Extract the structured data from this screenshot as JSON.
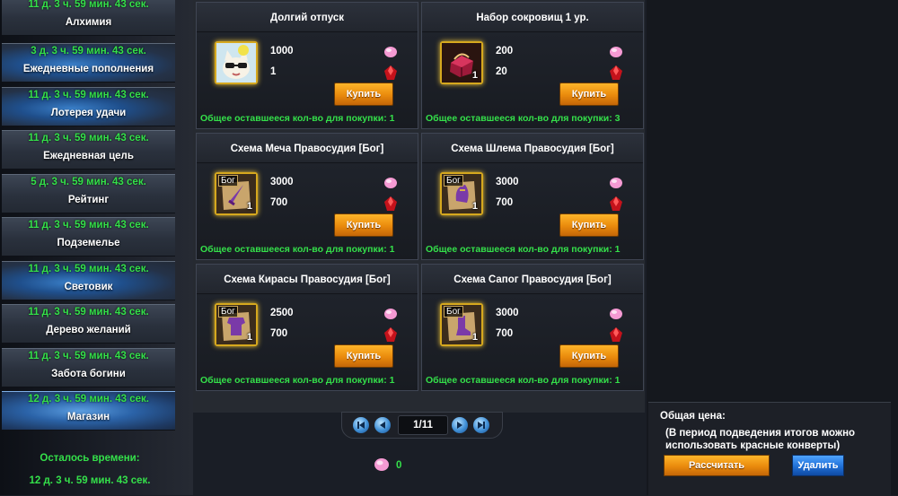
{
  "sidebar": {
    "items": [
      {
        "timer": "11 д. 3 ч. 59 мин. 43 сек.",
        "label": "Алхимия"
      },
      {
        "timer": "3 д. 3 ч. 59 мин. 43 сек.",
        "label": "Ежедневные пополнения"
      },
      {
        "timer": "11 д. 3 ч. 59 мин. 43 сек.",
        "label": "Лотерея удачи"
      },
      {
        "timer": "11 д. 3 ч. 59 мин. 43 сек.",
        "label": "Ежедневная цель"
      },
      {
        "timer": "5 д. 3 ч. 59 мин. 43 сек.",
        "label": "Рейтинг"
      },
      {
        "timer": "11 д. 3 ч. 59 мин. 43 сек.",
        "label": "Подземелье"
      },
      {
        "timer": "11 д. 3 ч. 59 мин. 43 сек.",
        "label": "Световик"
      },
      {
        "timer": "11 д. 3 ч. 59 мин. 43 сек.",
        "label": "Дерево желаний"
      },
      {
        "timer": "11 д. 3 ч. 59 мин. 43 сек.",
        "label": "Забота богини"
      },
      {
        "timer": "12 д. 3 ч. 59 мин. 43 сек.",
        "label": "Магазин"
      }
    ],
    "remaining_label": "Осталось времени:",
    "remaining_time": "12 д. 3 ч. 59 мин. 43 сек."
  },
  "shop": {
    "buy_label": "Купить",
    "items": [
      {
        "title": "Долгий отпуск",
        "price_1": "1000",
        "price_2": "1",
        "count": "",
        "tag": "",
        "remaining": "Общее оставшееся кол-во для покупки: 1",
        "icon": "cat-sunglasses-icon"
      },
      {
        "title": "Набор сокровищ 1 ур.",
        "price_1": "200",
        "price_2": "20",
        "count": "1",
        "tag": "",
        "remaining": "Общее оставшееся кол-во для покупки: 3",
        "icon": "treasure-box-icon"
      },
      {
        "title": "Схема Меча Правосудия [Бог]",
        "price_1": "3000",
        "price_2": "700",
        "count": "1",
        "tag": "Бог",
        "remaining": "Общее оставшееся кол-во для покупки: 1",
        "icon": "scroll-sword-icon"
      },
      {
        "title": "Схема Шлема Правосудия [Бог]",
        "price_1": "3000",
        "price_2": "700",
        "count": "1",
        "tag": "Бог",
        "remaining": "Общее оставшееся кол-во для покупки: 1",
        "icon": "scroll-helmet-icon"
      },
      {
        "title": "Схема Кирасы Правосудия [Бог]",
        "price_1": "2500",
        "price_2": "700",
        "count": "1",
        "tag": "Бог",
        "remaining": "Общее оставшееся кол-во для покупки: 1",
        "icon": "scroll-armor-icon"
      },
      {
        "title": "Схема Сапог Правосудия [Бог]",
        "price_1": "3000",
        "price_2": "700",
        "count": "1",
        "tag": "Бог",
        "remaining": "Общее оставшееся кол-во для покупки: 1",
        "icon": "scroll-boots-icon"
      }
    ]
  },
  "pager": {
    "page": "1/11"
  },
  "balance": {
    "value": "0",
    "icon": "pink-gem-icon"
  },
  "checkout": {
    "total_label": "Общая цена:",
    "note": "(В период подведения итогов можно использовать красные конверты)",
    "calc_label": "Рассчитать",
    "delete_label": "Удалить"
  },
  "colors": {
    "timer_green": "#34e04a",
    "buy_orange": "#e98a0c",
    "delete_blue": "#1f6fd6",
    "slot_gold": "#d6a81e"
  }
}
